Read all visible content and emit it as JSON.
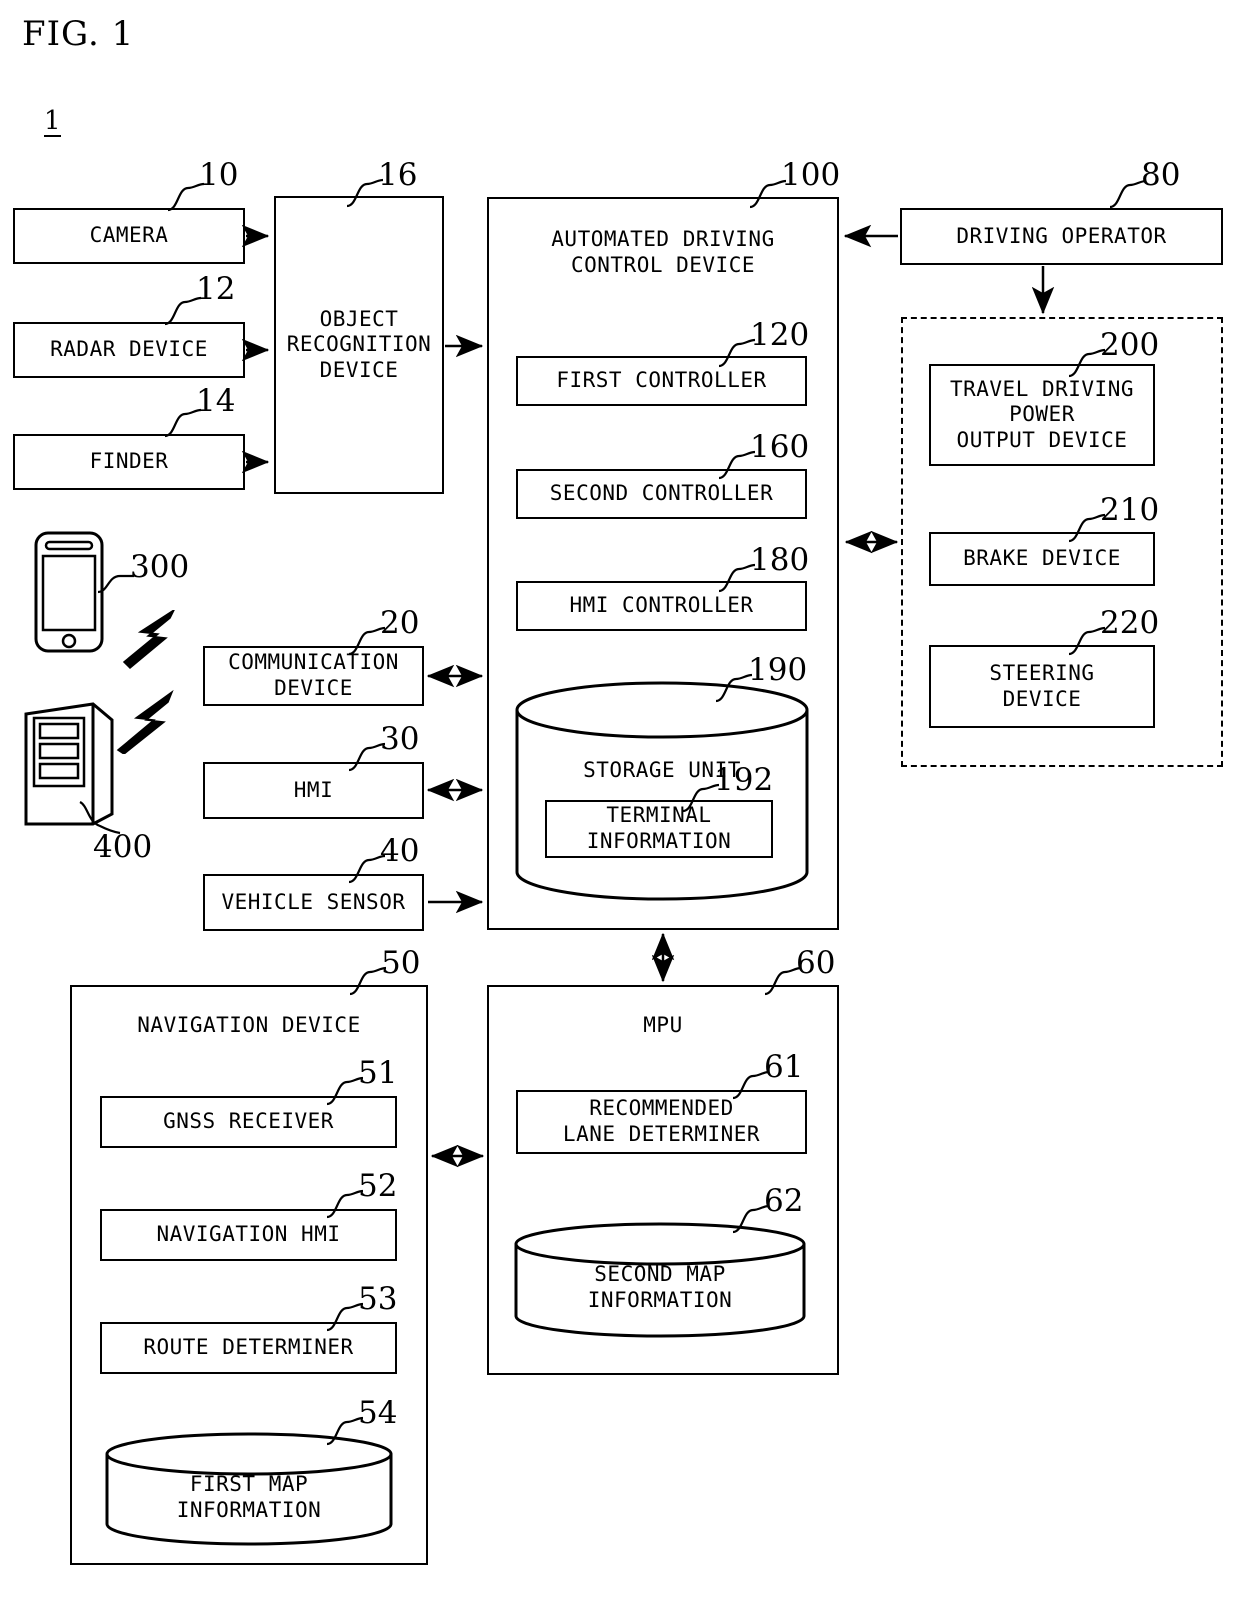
{
  "figure": {
    "caption": "FIG. 1",
    "system_numeral": "1"
  },
  "blocks": {
    "camera": {
      "label": "CAMERA",
      "ref": "10"
    },
    "radar": {
      "label": "RADAR DEVICE",
      "ref": "12"
    },
    "finder": {
      "label": "FINDER",
      "ref": "14"
    },
    "object_recognition": {
      "label": "OBJECT\nRECOGNITION\nDEVICE",
      "ref": "16"
    },
    "communication": {
      "label": "COMMUNICATION\nDEVICE",
      "ref": "20"
    },
    "hmi": {
      "label": "HMI",
      "ref": "30"
    },
    "vehicle_sensor": {
      "label": "VEHICLE SENSOR",
      "ref": "40"
    },
    "navigation_device": {
      "label": "NAVIGATION DEVICE",
      "ref": "50"
    },
    "gnss_receiver": {
      "label": "GNSS RECEIVER",
      "ref": "51"
    },
    "navigation_hmi": {
      "label": "NAVIGATION HMI",
      "ref": "52"
    },
    "route_determiner": {
      "label": "ROUTE DETERMINER",
      "ref": "53"
    },
    "first_map_info": {
      "label": "FIRST MAP\nINFORMATION",
      "ref": "54"
    },
    "mpu": {
      "label": "MPU",
      "ref": "60"
    },
    "recommended_lane": {
      "label": "RECOMMENDED\nLANE DETERMINER",
      "ref": "61"
    },
    "second_map_info": {
      "label": "SECOND MAP\nINFORMATION",
      "ref": "62"
    },
    "driving_operator": {
      "label": "DRIVING OPERATOR",
      "ref": "80"
    },
    "control_device": {
      "label": "AUTOMATED DRIVING\nCONTROL DEVICE",
      "ref": "100"
    },
    "first_controller": {
      "label": "FIRST CONTROLLER",
      "ref": "120"
    },
    "second_controller": {
      "label": "SECOND CONTROLLER",
      "ref": "160"
    },
    "hmi_controller": {
      "label": "HMI CONTROLLER",
      "ref": "180"
    },
    "storage_unit": {
      "label": "STORAGE UNIT",
      "ref": "190"
    },
    "terminal_info": {
      "label": "TERMINAL\nINFORMATION",
      "ref": "192"
    },
    "travel_power": {
      "label": "TRAVEL DRIVING\nPOWER\nOUTPUT DEVICE",
      "ref": "200"
    },
    "brake_device": {
      "label": "BRAKE DEVICE",
      "ref": "210"
    },
    "steering_device": {
      "label": "STEERING\nDEVICE",
      "ref": "220"
    },
    "terminal_icon": {
      "label": "",
      "ref": "300"
    },
    "server_icon": {
      "label": "",
      "ref": "400"
    },
    "actuator_group": {
      "label": "",
      "ref": ""
    }
  },
  "icons": [
    {
      "name": "smartphone-icon",
      "ref": "300"
    },
    {
      "name": "server-icon",
      "ref": "400"
    },
    {
      "name": "wireless-bolt-icon",
      "count": 2
    }
  ],
  "colors": {
    "line": "#000000",
    "background": "#ffffff"
  }
}
